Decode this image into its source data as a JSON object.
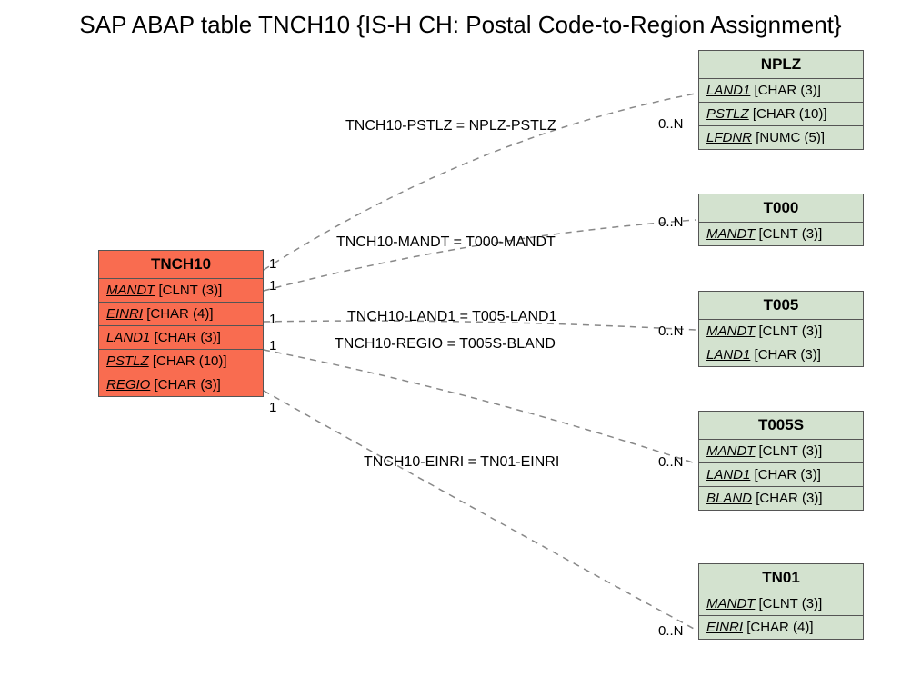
{
  "title": "SAP ABAP table TNCH10 {IS-H CH: Postal Code-to-Region Assignment}",
  "main": {
    "name": "TNCH10",
    "fields": [
      {
        "key": "MANDT",
        "type": "[CLNT (3)]"
      },
      {
        "key": "EINRI",
        "type": "[CHAR (4)]"
      },
      {
        "key": "LAND1",
        "type": "[CHAR (3)]"
      },
      {
        "key": "PSTLZ",
        "type": "[CHAR (10)]"
      },
      {
        "key": "REGIO",
        "type": "[CHAR (3)]"
      }
    ]
  },
  "targets": {
    "NPLZ": {
      "fields": [
        {
          "key": "LAND1",
          "type": "[CHAR (3)]"
        },
        {
          "key": "PSTLZ",
          "type": "[CHAR (10)]"
        },
        {
          "key": "LFDNR",
          "type": "[NUMC (5)]"
        }
      ]
    },
    "T000": {
      "fields": [
        {
          "key": "MANDT",
          "type": "[CLNT (3)]"
        }
      ]
    },
    "T005": {
      "fields": [
        {
          "key": "MANDT",
          "type": "[CLNT (3)]"
        },
        {
          "key": "LAND1",
          "type": "[CHAR (3)]"
        }
      ]
    },
    "T005S": {
      "fields": [
        {
          "key": "MANDT",
          "type": "[CLNT (3)]"
        },
        {
          "key": "LAND1",
          "type": "[CHAR (3)]"
        },
        {
          "key": "BLAND",
          "type": "[CHAR (3)]"
        }
      ]
    },
    "TN01": {
      "fields": [
        {
          "key": "MANDT",
          "type": "[CLNT (3)]"
        },
        {
          "key": "EINRI",
          "type": "[CHAR (4)]"
        }
      ]
    }
  },
  "relations": [
    {
      "label": "TNCH10-PSTLZ = NPLZ-PSTLZ",
      "src_card": "1",
      "dst_card": "0..N"
    },
    {
      "label": "TNCH10-MANDT = T000-MANDT",
      "src_card": "1",
      "dst_card": "0..N"
    },
    {
      "label": "TNCH10-LAND1 = T005-LAND1",
      "src_card": "1",
      "dst_card": "0..N"
    },
    {
      "label": "TNCH10-REGIO = T005S-BLAND",
      "src_card": "1",
      "dst_card": "0..N"
    },
    {
      "label": "TNCH10-EINRI = TN01-EINRI",
      "src_card": "1",
      "dst_card": "0..N"
    }
  ],
  "chart_data": {
    "type": "table",
    "description": "ER diagram: central table TNCH10 linked 1 to 0..N to NPLZ, T000, T005, T005S, TN01 via listed join conditions."
  }
}
